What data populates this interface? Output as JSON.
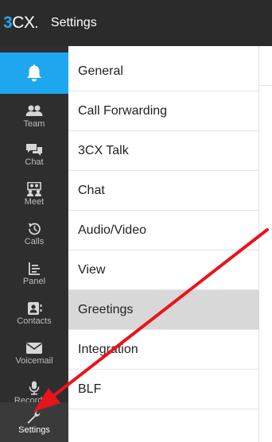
{
  "header": {
    "logo_3": "3",
    "logo_cx": "CX",
    "logo_dot": ".",
    "title": "Settings"
  },
  "rail": {
    "items": [
      {
        "label": "Team",
        "icon": "team-icon"
      },
      {
        "label": "Chat",
        "icon": "chat-icon"
      },
      {
        "label": "Meet",
        "icon": "meet-icon"
      },
      {
        "label": "Calls",
        "icon": "calls-icon"
      },
      {
        "label": "Panel",
        "icon": "panel-icon"
      },
      {
        "label": "Contacts",
        "icon": "contacts-icon"
      },
      {
        "label": "Voicemail",
        "icon": "voicemail-icon"
      },
      {
        "label": "Recording",
        "icon": "microphone-icon"
      },
      {
        "label": "Settings",
        "icon": "wrench-icon"
      }
    ]
  },
  "menu": {
    "items": [
      {
        "label": "General"
      },
      {
        "label": "Call Forwarding"
      },
      {
        "label": "3CX Talk"
      },
      {
        "label": "Chat"
      },
      {
        "label": "Audio/Video"
      },
      {
        "label": "View"
      },
      {
        "label": "Greetings"
      },
      {
        "label": "Integration"
      },
      {
        "label": "BLF"
      }
    ],
    "selected": "Greetings"
  },
  "colors": {
    "accent": "#1ea7ee",
    "topbar": "#2b2b2b",
    "rail": "#2e2e2e",
    "selected_row": "#d8d8d8",
    "annotation_arrow": "#e8141c"
  }
}
